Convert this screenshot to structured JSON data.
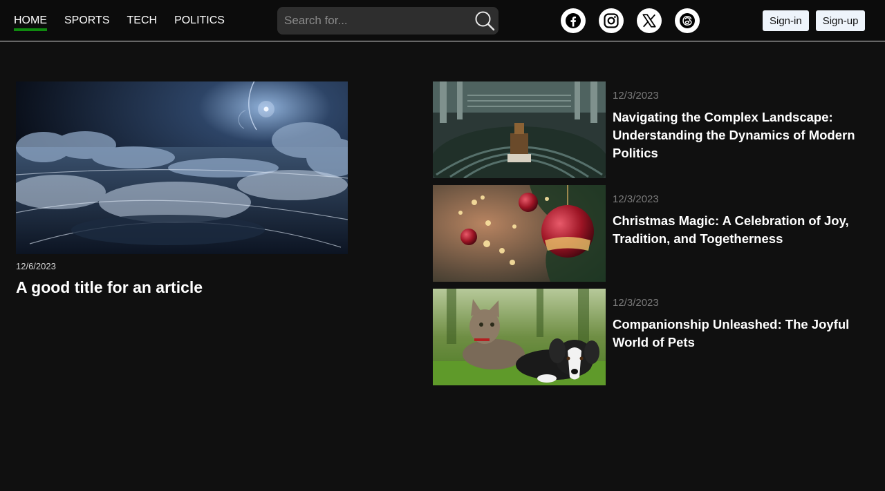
{
  "nav": {
    "items": [
      {
        "label": "HOME",
        "active": true
      },
      {
        "label": "SPORTS",
        "active": false
      },
      {
        "label": "TECH",
        "active": false
      },
      {
        "label": "POLITICS",
        "active": false
      }
    ]
  },
  "search": {
    "placeholder": "Search for...",
    "value": "",
    "icon": "search-icon"
  },
  "socials": [
    "facebook-icon",
    "instagram-icon",
    "x-icon",
    "threads-icon"
  ],
  "auth": {
    "signin_label": "Sign-in",
    "signup_label": "Sign-up"
  },
  "featured": {
    "date": "12/6/2023",
    "title": "A good title for an article"
  },
  "articles": [
    {
      "date": "12/3/2023",
      "title": "Navigating the Complex Landscape: Understanding the Dynamics of Modern Politics"
    },
    {
      "date": "12/3/2023",
      "title": "Christmas Magic: A Celebration of Joy, Tradition, and Togetherness"
    },
    {
      "date": "12/3/2023",
      "title": "Companionship Unleashed: The Joyful World of Pets"
    }
  ],
  "colors": {
    "background": "#101010",
    "nav_active_underline": "#0f8a0f",
    "search_bg": "#2e2e2e",
    "auth_button_bg": "#eef4fb",
    "muted_date": "#7a7a7a"
  }
}
